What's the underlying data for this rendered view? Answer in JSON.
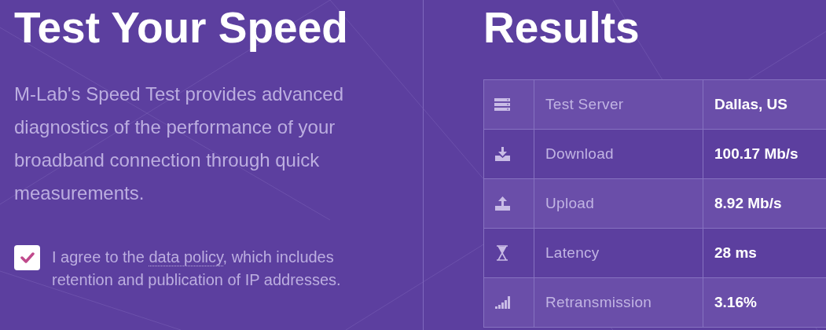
{
  "test": {
    "title": "Test Your Speed",
    "description": "M-Lab's Speed Test provides advanced diagnostics of the performance of your broadband connection through quick measurements.",
    "agreement": {
      "checked": true,
      "text_before": "I agree to the ",
      "link": "data policy",
      "text_after": ", which includes retention and publication of IP addresses."
    }
  },
  "results": {
    "title": "Results",
    "rows": [
      {
        "label": "Test Server",
        "value": "Dallas, US"
      },
      {
        "label": "Download",
        "value": "100.17 Mb/s"
      },
      {
        "label": "Upload",
        "value": "8.92 Mb/s"
      },
      {
        "label": "Latency",
        "value": "28 ms"
      },
      {
        "label": "Retransmission",
        "value": "3.16%"
      }
    ]
  }
}
